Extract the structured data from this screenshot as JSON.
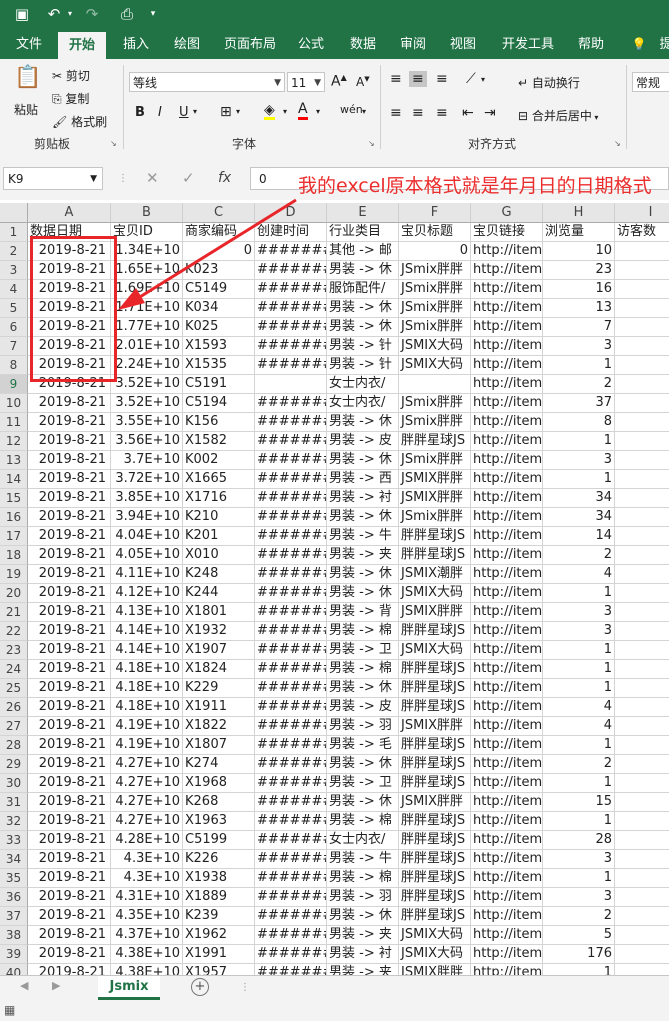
{
  "qat": {
    "save_icon": "save-icon",
    "undo_icon": "undo-icon",
    "redo_icon": "redo-icon",
    "preview_icon": "print-preview-icon"
  },
  "tabs": [
    "文件",
    "开始",
    "插入",
    "绘图",
    "页面布局",
    "公式",
    "数据",
    "审阅",
    "视图",
    "开发工具",
    "帮助",
    "提"
  ],
  "active_tab": "开始",
  "ribbon": {
    "clipboard": {
      "paste": "粘贴",
      "cut": "剪切",
      "copy": "复制",
      "format_painter": "格式刷",
      "group": "剪贴板"
    },
    "font": {
      "font_name": "等线",
      "font_size": "11",
      "group": "字体",
      "bold": "B",
      "italic": "I",
      "underline": "U",
      "grow": "A",
      "shrink": "A"
    },
    "alignment": {
      "wrap_text": "自动换行",
      "merge_center": "合并后居中",
      "group": "对齐方式"
    },
    "number": {
      "format": "常规"
    }
  },
  "formula_bar": {
    "name_box": "K9",
    "fx": "fx",
    "value": "0"
  },
  "annotation": {
    "text": "我的excel原本格式就是年月日的日期格式",
    "color": "#ec2d2d"
  },
  "sheet": {
    "columns": [
      "A",
      "B",
      "C",
      "D",
      "E",
      "F",
      "G",
      "H",
      "I"
    ],
    "active_row": 9,
    "header": [
      "数据日期",
      "宝贝ID",
      "商家编码",
      "创建时间",
      "行业类目",
      "宝贝标题",
      "宝贝链接",
      "浏览量",
      "访客数"
    ],
    "rows": [
      [
        "2019-8-21",
        "1.34E+10",
        "0",
        "#######",
        "其他 -> 邮",
        "0",
        "http://item",
        "10",
        ""
      ],
      [
        "2019-8-21",
        "1.65E+10",
        "K023",
        "#######",
        "男装 -> 休",
        "JSmix胖胖",
        "http://item",
        "23",
        ""
      ],
      [
        "2019-8-21",
        "1.69E+10",
        "C5149",
        "#######",
        "服饰配件/",
        "JSmix胖胖",
        "http://item",
        "16",
        ""
      ],
      [
        "2019-8-21",
        "1.71E+10",
        "K034",
        "#######",
        "男装 -> 休",
        "JSmix胖胖",
        "http://item",
        "13",
        ""
      ],
      [
        "2019-8-21",
        "1.77E+10",
        "K025",
        "#######",
        "男装 -> 休",
        "JSmix胖胖",
        "http://item",
        "7",
        ""
      ],
      [
        "2019-8-21",
        "2.01E+10",
        "X1593",
        "#######",
        "男装 -> 针",
        "JSMIX大码",
        "http://item",
        "3",
        ""
      ],
      [
        "2019-8-21",
        "2.24E+10",
        "X1535",
        "#######",
        "男装 -> 针",
        "JSMIX大码",
        "http://item",
        "1",
        ""
      ],
      [
        "2019-8-21",
        "3.52E+10",
        "C5191",
        "",
        "女士内衣/",
        "",
        "http://item",
        "2",
        ""
      ],
      [
        "2019-8-21",
        "3.52E+10",
        "C5194",
        "#######",
        "女士内衣/",
        "JSmix胖胖",
        "http://item",
        "37",
        ""
      ],
      [
        "2019-8-21",
        "3.55E+10",
        "K156",
        "#######",
        "男装 -> 休",
        "JSmix胖胖",
        "http://item",
        "8",
        ""
      ],
      [
        "2019-8-21",
        "3.56E+10",
        "X1582",
        "#######",
        "男装 -> 皮",
        "胖胖星球JS",
        "http://item",
        "1",
        ""
      ],
      [
        "2019-8-21",
        "3.7E+10",
        "K002",
        "#######",
        "男装 -> 休",
        "JSmix胖胖",
        "http://item",
        "3",
        ""
      ],
      [
        "2019-8-21",
        "3.72E+10",
        "X1665",
        "#######",
        "男装 -> 西",
        "JSMIX胖胖",
        "http://item",
        "1",
        ""
      ],
      [
        "2019-8-21",
        "3.85E+10",
        "X1716",
        "#######",
        "男装 -> 衬",
        "JSMIX胖胖",
        "http://item",
        "34",
        ""
      ],
      [
        "2019-8-21",
        "3.94E+10",
        "K210",
        "#######",
        "男装 -> 休",
        "JSmix胖胖",
        "http://item",
        "34",
        ""
      ],
      [
        "2019-8-21",
        "4.04E+10",
        "K201",
        "#######",
        "男装 -> 牛",
        "胖胖星球JS",
        "http://item",
        "14",
        ""
      ],
      [
        "2019-8-21",
        "4.05E+10",
        "X010",
        "#######",
        "男装 -> 夹",
        "胖胖星球JS",
        "http://item",
        "2",
        ""
      ],
      [
        "2019-8-21",
        "4.11E+10",
        "K248",
        "#######",
        "男装 -> 休",
        "JSMIX潮胖",
        "http://item",
        "4",
        ""
      ],
      [
        "2019-8-21",
        "4.12E+10",
        "K244",
        "#######",
        "男装 -> 休",
        "JSMIX大码",
        "http://item",
        "1",
        ""
      ],
      [
        "2019-8-21",
        "4.13E+10",
        "X1801",
        "#######",
        "男装 -> 背",
        "JSMIX胖胖",
        "http://item",
        "3",
        ""
      ],
      [
        "2019-8-21",
        "4.14E+10",
        "X1932",
        "#######",
        "男装 -> 棉",
        "胖胖星球JS",
        "http://item",
        "3",
        ""
      ],
      [
        "2019-8-21",
        "4.14E+10",
        "X1907",
        "#######",
        "男装 -> 卫",
        "JSMIX大码",
        "http://item",
        "1",
        ""
      ],
      [
        "2019-8-21",
        "4.18E+10",
        "X1824",
        "#######",
        "男装 -> 棉",
        "胖胖星球JS",
        "http://item",
        "1",
        ""
      ],
      [
        "2019-8-21",
        "4.18E+10",
        "K229",
        "#######",
        "男装 -> 休",
        "胖胖星球JS",
        "http://item",
        "1",
        ""
      ],
      [
        "2019-8-21",
        "4.18E+10",
        "X1911",
        "#######",
        "男装 -> 皮",
        "胖胖星球JS",
        "http://item",
        "4",
        ""
      ],
      [
        "2019-8-21",
        "4.19E+10",
        "X1822",
        "#######",
        "男装 -> 羽",
        "JSMIX胖胖",
        "http://item",
        "4",
        ""
      ],
      [
        "2019-8-21",
        "4.19E+10",
        "X1807",
        "#######",
        "男装 -> 毛",
        "胖胖星球JS",
        "http://item",
        "1",
        ""
      ],
      [
        "2019-8-21",
        "4.27E+10",
        "K274",
        "#######",
        "男装 -> 休",
        "胖胖星球JS",
        "http://item",
        "2",
        ""
      ],
      [
        "2019-8-21",
        "4.27E+10",
        "X1968",
        "#######",
        "男装 -> 卫",
        "胖胖星球JS",
        "http://item",
        "1",
        ""
      ],
      [
        "2019-8-21",
        "4.27E+10",
        "K268",
        "#######",
        "男装 -> 休",
        "JSMIX胖胖",
        "http://item",
        "15",
        ""
      ],
      [
        "2019-8-21",
        "4.27E+10",
        "X1963",
        "#######",
        "男装 -> 棉",
        "胖胖星球JS",
        "http://item",
        "1",
        ""
      ],
      [
        "2019-8-21",
        "4.28E+10",
        "C5199",
        "#######",
        "女士内衣/",
        "胖胖星球JS",
        "http://item",
        "28",
        ""
      ],
      [
        "2019-8-21",
        "4.3E+10",
        "K226",
        "#######",
        "男装 -> 牛",
        "胖胖星球JS",
        "http://item",
        "3",
        ""
      ],
      [
        "2019-8-21",
        "4.3E+10",
        "X1938",
        "#######",
        "男装 -> 棉",
        "胖胖星球JS",
        "http://item",
        "1",
        ""
      ],
      [
        "2019-8-21",
        "4.31E+10",
        "X1889",
        "#######",
        "男装 -> 羽",
        "胖胖星球JS",
        "http://item",
        "3",
        ""
      ],
      [
        "2019-8-21",
        "4.35E+10",
        "K239",
        "#######",
        "男装 -> 休",
        "胖胖星球JS",
        "http://item",
        "2",
        ""
      ],
      [
        "2019-8-21",
        "4.37E+10",
        "X1962",
        "#######",
        "男装 -> 夹",
        "JSMIX大码",
        "http://item",
        "5",
        ""
      ],
      [
        "2019-8-21",
        "4.38E+10",
        "X1991",
        "#######",
        "男装 -> 衬",
        "JSMIX大码",
        "http://item",
        "176",
        ""
      ],
      [
        "2019-8-21",
        "4.38E+10",
        "X1957",
        "#######",
        "男装 -> 夹",
        "JSMIX胖胖",
        "http://item",
        "1",
        ""
      ]
    ]
  },
  "sheet_tab": "Jsmix",
  "colors": {
    "accent": "#217346",
    "annotation": "#ec2d2d"
  }
}
